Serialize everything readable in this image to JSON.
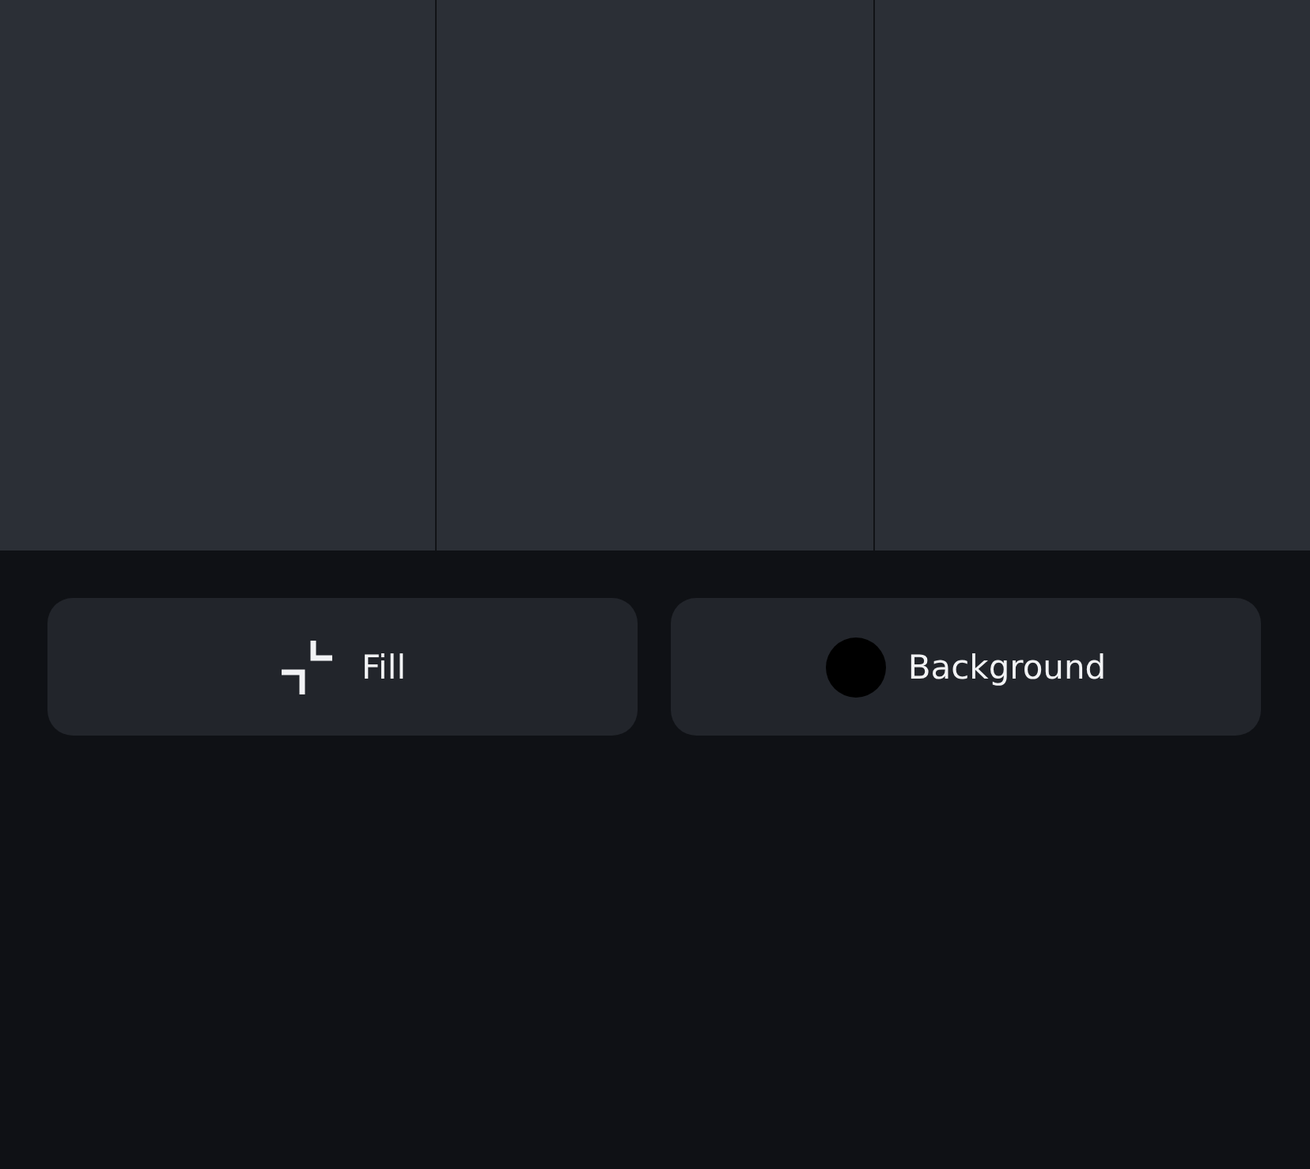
{
  "buttons": [
    {
      "kind": "fill",
      "label": "Fill"
    },
    {
      "kind": "background",
      "label": "Background",
      "color": "#000000"
    }
  ]
}
